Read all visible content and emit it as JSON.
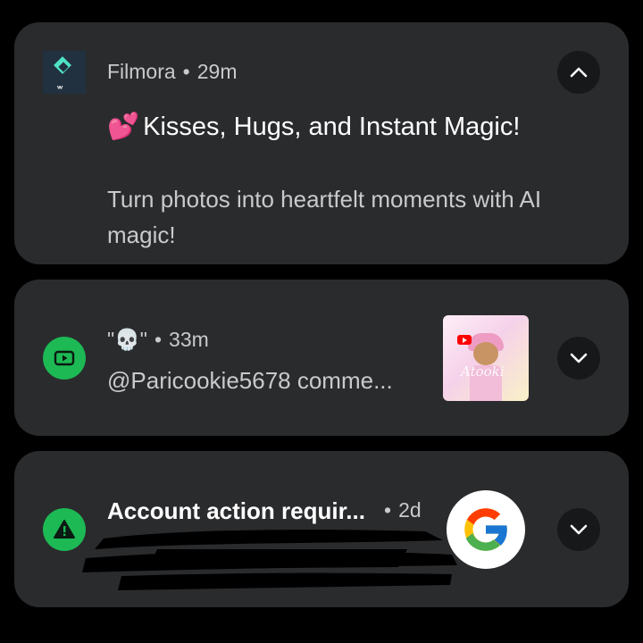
{
  "notifications": [
    {
      "app_name": "Filmora",
      "time": "29m",
      "title_emoji": "💕",
      "title": "Kisses, Hugs, and Instant Magic!",
      "body": "Turn photos into heartfelt moments with AI magic!",
      "expanded": true,
      "icon": "filmora-app-icon"
    },
    {
      "sender": "\"💀\"",
      "time": "33m",
      "text": "@Paricookie5678 comme...",
      "expanded": false,
      "icon": "youtube-icon",
      "thumbnail": "avatar-thumbnail",
      "thumbnail_text": "Atooki"
    },
    {
      "title": "Account action requir...",
      "time": "2d",
      "expanded": false,
      "icon": "warning-icon",
      "badge": "google-logo"
    }
  ],
  "colors": {
    "background": "#000000",
    "card": "#2a2b2d",
    "accent_green": "#1db954",
    "text_primary": "#ffffff",
    "text_secondary": "#c9cacc"
  },
  "separator": "•"
}
